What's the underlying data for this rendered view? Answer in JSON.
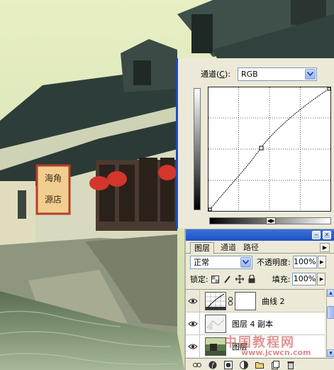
{
  "curves": {
    "channel_label": "通道(",
    "channel_hotkey": "C",
    "channel_label_end": "):",
    "channel_value": "RGB"
  },
  "layers_panel": {
    "tabs": [
      "图层",
      "通道",
      "路径"
    ],
    "blend_mode": "正常",
    "opacity_label": "不透明度:",
    "opacity_value": "100%",
    "lock_label": "锁定:",
    "fill_label": "填充:",
    "fill_value": "100%",
    "layers": [
      {
        "name": "曲线 2",
        "type": "adjustment"
      },
      {
        "name": "图层 4 副本",
        "type": "image"
      },
      {
        "name": "图层",
        "type": "image"
      }
    ]
  },
  "photo": {
    "shop_sign_text": "海角源店"
  },
  "watermark": {
    "text": "中国教程网",
    "url": "www.jcwcn.com"
  }
}
